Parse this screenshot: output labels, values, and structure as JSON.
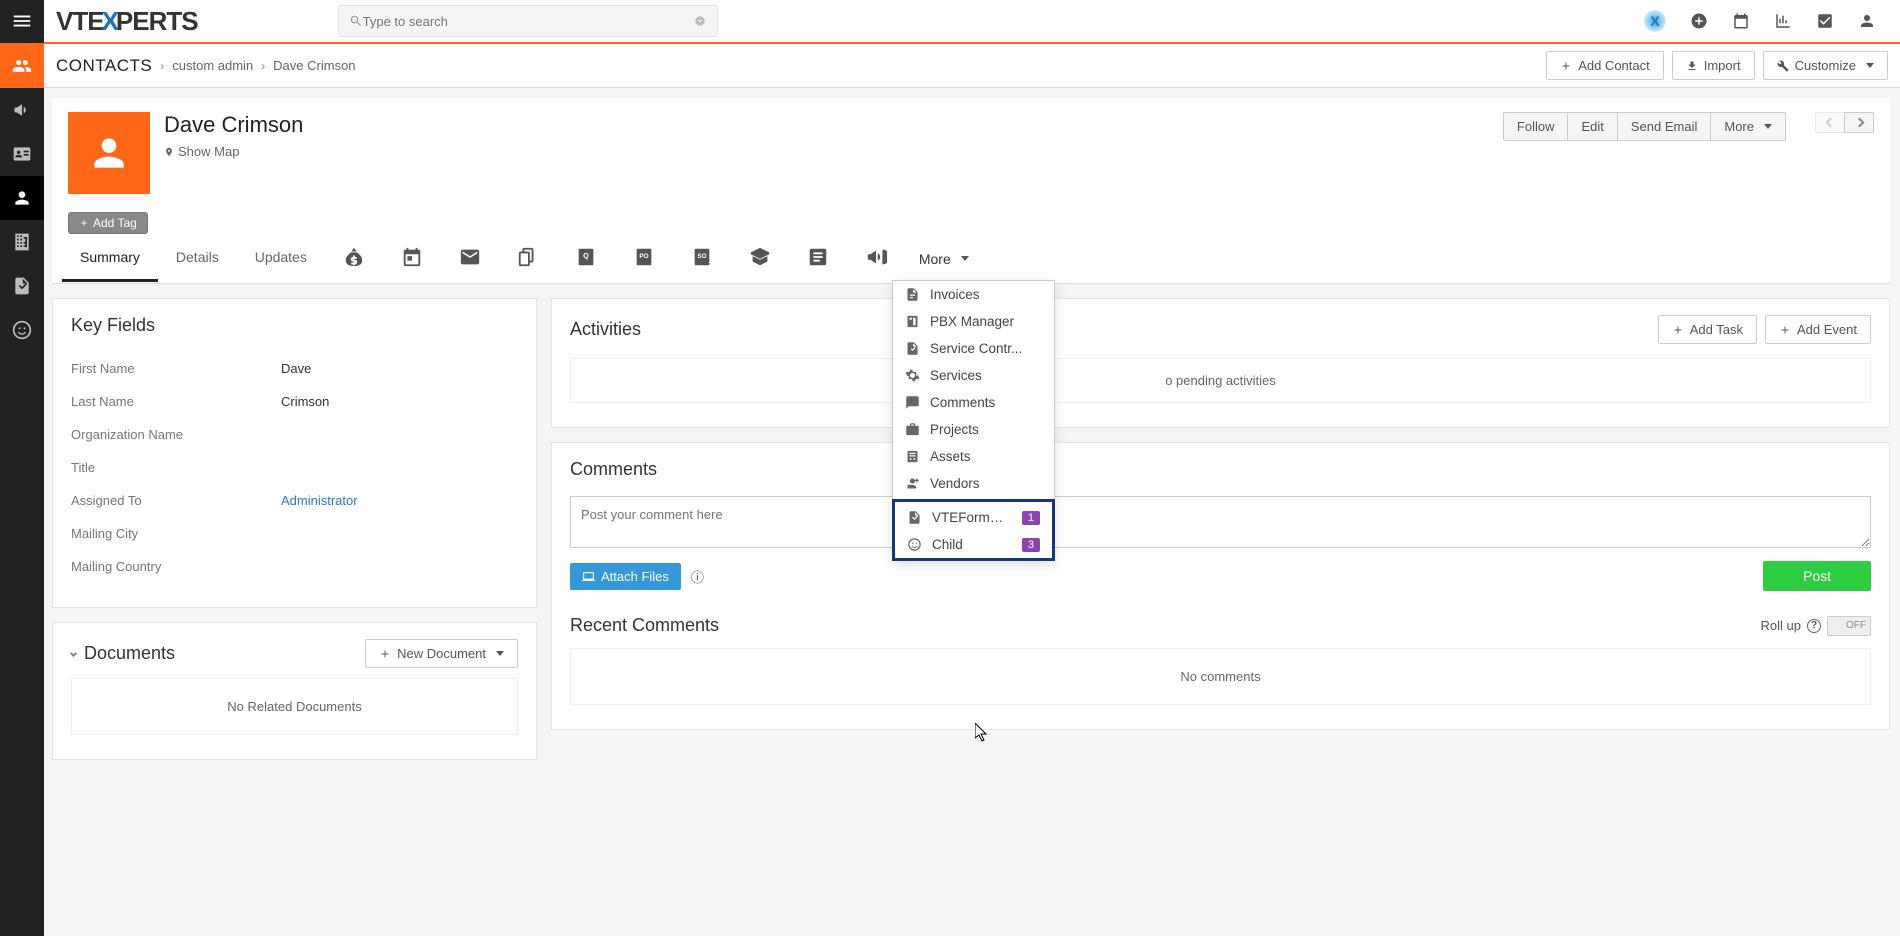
{
  "search": {
    "placeholder": "Type to search"
  },
  "breadcrumb": {
    "module": "CONTACTS",
    "path1": "custom admin",
    "path2": "Dave Crimson",
    "add": "Add Contact",
    "import": "Import",
    "customize": "Customize"
  },
  "record": {
    "name": "Dave Crimson",
    "show_map": "Show Map",
    "add_tag": "Add Tag",
    "follow": "Follow",
    "edit": "Edit",
    "send_email": "Send Email",
    "more": "More"
  },
  "tabs": {
    "summary": "Summary",
    "details": "Details",
    "updates": "Updates",
    "more": "More"
  },
  "dropdown": {
    "invoices": "Invoices",
    "pbx": "PBX Manager",
    "service_contr": "Service Contr...",
    "services": "Services",
    "comments": "Comments",
    "projects": "Projects",
    "assets": "Assets",
    "vendors": "Vendors",
    "vteform": "VTEFormSub...",
    "vteform_badge": "1",
    "child": "Child",
    "child_badge": "3"
  },
  "key_fields": {
    "title": "Key Fields",
    "rows": {
      "first_name": {
        "label": "First Name",
        "value": "Dave"
      },
      "last_name": {
        "label": "Last Name",
        "value": "Crimson"
      },
      "org": {
        "label": "Organization Name",
        "value": ""
      },
      "title_f": {
        "label": "Title",
        "value": ""
      },
      "assigned": {
        "label": "Assigned To",
        "value": "Administrator"
      },
      "city": {
        "label": "Mailing City",
        "value": ""
      },
      "country": {
        "label": "Mailing Country",
        "value": ""
      }
    }
  },
  "documents": {
    "title": "Documents",
    "new": "New Document",
    "empty": "No Related Documents"
  },
  "activities": {
    "title": "Activities",
    "add_task": "Add Task",
    "add_event": "Add Event",
    "empty": "o pending activities"
  },
  "comments": {
    "title": "Comments",
    "placeholder": "Post your comment here",
    "attach": "Attach Files",
    "post": "Post",
    "recent_title": "Recent Comments",
    "rollup": "Roll up",
    "toggle": "OFF",
    "no_comments": "No comments"
  }
}
